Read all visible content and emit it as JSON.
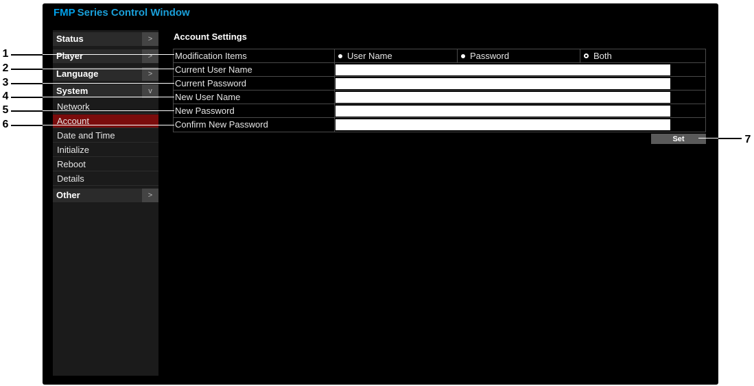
{
  "window": {
    "title_brand": "FMP",
    "title_rest": "Series Control Window"
  },
  "sidebar": {
    "sections": [
      {
        "label": "Status",
        "chevron": ">"
      },
      {
        "label": "Player",
        "chevron": ">"
      },
      {
        "label": "Language",
        "chevron": ">"
      },
      {
        "label": "System",
        "chevron": "v"
      }
    ],
    "system_items": [
      {
        "label": "Network"
      },
      {
        "label": "Account",
        "active": true
      },
      {
        "label": "Date and Time"
      },
      {
        "label": "Initialize"
      },
      {
        "label": "Reboot"
      },
      {
        "label": "Details"
      }
    ],
    "other": {
      "label": "Other",
      "chevron": ">"
    }
  },
  "main": {
    "section_title": "Account Settings",
    "modification_items": {
      "label": "Modification Items",
      "options": [
        "User Name",
        "Password",
        "Both"
      ],
      "selected": "Both"
    },
    "fields": [
      {
        "label": "Current User Name",
        "value": ""
      },
      {
        "label": "Current Password",
        "value": ""
      },
      {
        "label": "New User Name",
        "value": ""
      },
      {
        "label": "New Password",
        "value": ""
      },
      {
        "label": "Confirm New Password",
        "value": ""
      }
    ],
    "set_button": "Set"
  },
  "callouts": [
    "1",
    "2",
    "3",
    "4",
    "5",
    "6",
    "7"
  ],
  "colors": {
    "brand": "#00a0e9",
    "active_item": "#7a0c0c",
    "background": "#000000"
  }
}
